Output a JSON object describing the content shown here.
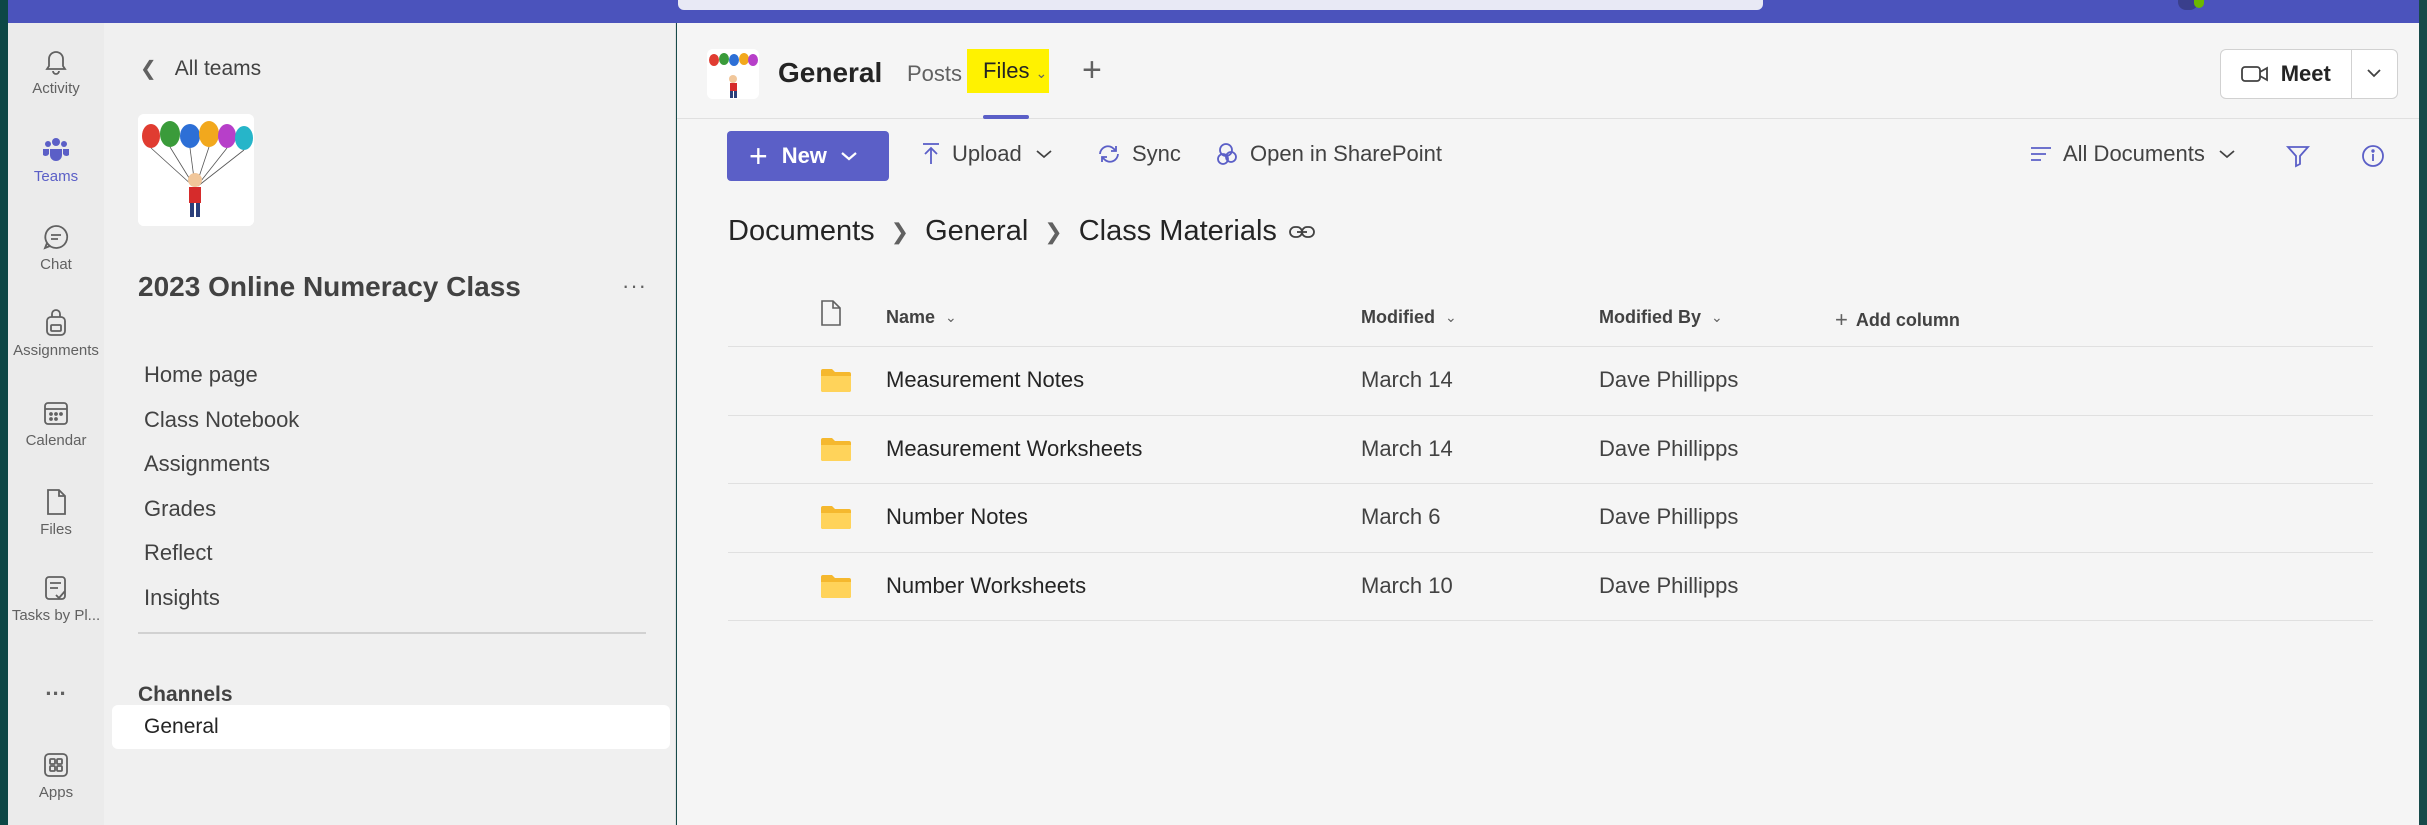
{
  "rail": {
    "items": [
      {
        "label": "Activity",
        "icon": "bell-icon"
      },
      {
        "label": "Teams",
        "icon": "teams-icon"
      },
      {
        "label": "Chat",
        "icon": "chat-icon"
      },
      {
        "label": "Assignments",
        "icon": "backpack-icon"
      },
      {
        "label": "Calendar",
        "icon": "calendar-icon"
      },
      {
        "label": "Files",
        "icon": "file-icon"
      },
      {
        "label": "Tasks by Pl...",
        "icon": "tasks-icon"
      },
      {
        "label": "...",
        "icon": "more-icon"
      },
      {
        "label": "Apps",
        "icon": "apps-icon"
      }
    ],
    "active": "Teams"
  },
  "team": {
    "back_label": "All teams",
    "name": "2023 Online Numeracy Class",
    "more": "···",
    "nav": [
      "Home page",
      "Class Notebook",
      "Assignments",
      "Grades",
      "Reflect",
      "Insights"
    ],
    "channels_heading": "Channels",
    "channels": [
      "General"
    ]
  },
  "channel": {
    "title": "General",
    "tabs": {
      "posts": "Posts",
      "files": "Files"
    },
    "add_tab": "+",
    "meet_label": "Meet"
  },
  "commands": {
    "new_label": "New",
    "upload_label": "Upload",
    "sync_label": "Sync",
    "sharepoint_label": "Open in SharePoint",
    "view_label": "All Documents"
  },
  "breadcrumb": {
    "items": [
      "Documents",
      "General",
      "Class Materials"
    ]
  },
  "table": {
    "columns": {
      "name": "Name",
      "modified": "Modified",
      "modified_by": "Modified By",
      "add": "Add column"
    },
    "rows": [
      {
        "name": "Measurement Notes",
        "modified": "March 14",
        "modified_by": "Dave Phillipps"
      },
      {
        "name": "Measurement Worksheets",
        "modified": "March 14",
        "modified_by": "Dave Phillipps"
      },
      {
        "name": "Number Notes",
        "modified": "March 6",
        "modified_by": "Dave Phillipps"
      },
      {
        "name": "Number Worksheets",
        "modified": "March 10",
        "modified_by": "Dave Phillipps"
      }
    ]
  },
  "colors": {
    "brand": "#5b5fc7",
    "topbar": "#4b53bc",
    "highlight": "#fff200",
    "folder": "#ffc83d"
  }
}
